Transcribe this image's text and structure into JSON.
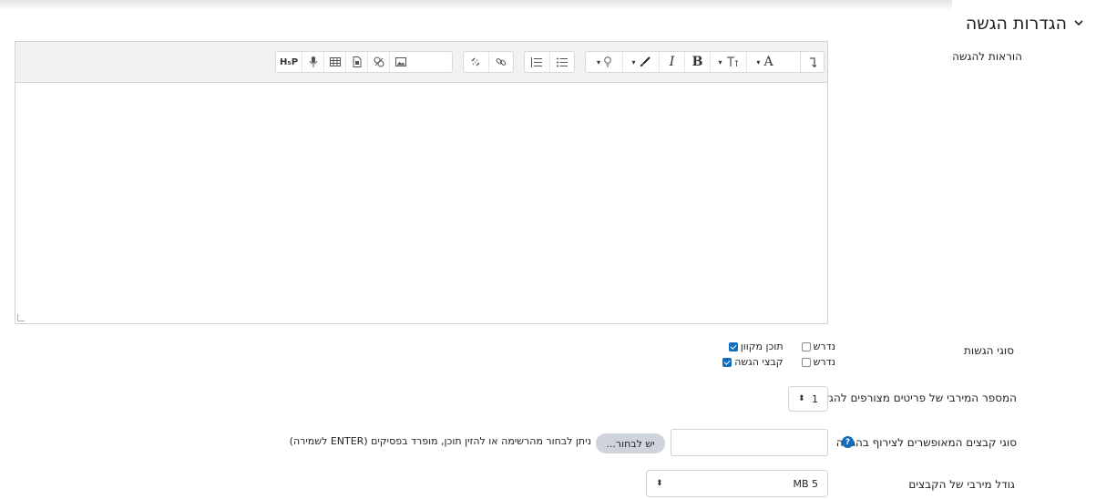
{
  "section": {
    "title": "הגדרות הגשה",
    "icon": "chevron-down-icon"
  },
  "fields": {
    "instructions_label": "הוראות להגשה",
    "submission_types_label": "סוגי הגשות",
    "max_items_label": "המספר המירבי של פריטים מצורפים להגשה",
    "accepted_types_label": "סוגי קבצים המאופשרים לצירוף בהגשה",
    "max_size_label": "גודל מירבי של הקבצים"
  },
  "submission_types": [
    {
      "label": "תוכן מקוון",
      "checked": true,
      "required_label": "נדרש",
      "required_checked": false
    },
    {
      "label": "קבצי הגשה",
      "checked": true,
      "required_label": "נדרש",
      "required_checked": false
    }
  ],
  "max_items": {
    "value": "1"
  },
  "accepted_types": {
    "value": "",
    "choose_button": "יש לבחור...",
    "help_text": "ניתן לבחור מהרשימה או להזין תוכן, מופרד בפסיקים (ENTER לשמירה)"
  },
  "max_size": {
    "value": "MB 5"
  },
  "toolbar": {
    "a11y_label": "H₅P",
    "bold": "B",
    "italic": "I",
    "font": "A",
    "icons": [
      "rtl-icon",
      "font-color-icon",
      "font-size-icon",
      "bold-icon",
      "italic-icon",
      "brush-icon",
      "bulb-icon",
      "unordered-list-icon",
      "ordered-list-icon",
      "link-icon",
      "unlink-icon",
      "image-icon",
      "media-icon",
      "file-icon",
      "table-icon",
      "microphone-icon",
      "h5p-icon"
    ]
  },
  "colors": {
    "accent": "#0f6cbf",
    "border": "#ced4da",
    "button": "#ced4da"
  }
}
